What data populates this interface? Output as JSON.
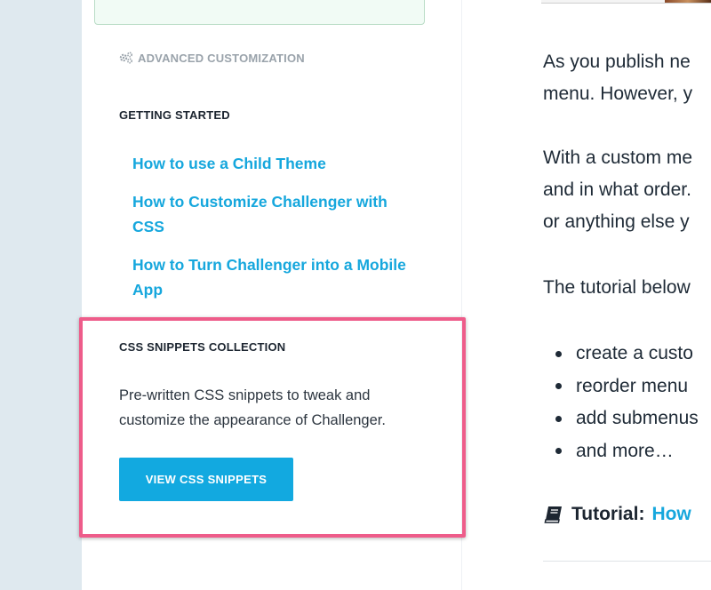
{
  "sidebar": {
    "advanced_label": "ADVANCED CUSTOMIZATION",
    "advanced_icon": "gears-icon",
    "getting_started": {
      "heading": "GETTING STARTED",
      "links": [
        {
          "line1": "How to use a Child Theme",
          "line2": ""
        },
        {
          "line1": "How to Customize Challenger with",
          "line2": "CSS"
        },
        {
          "line1": "How to Turn Challenger into a Mobile",
          "line2": "App"
        }
      ]
    },
    "snippets": {
      "heading": "CSS SNIPPETS COLLECTION",
      "desc_line1": "Pre-written CSS snippets to tweak and",
      "desc_line2": "customize the appearance of Challenger.",
      "button_label": "VIEW CSS SNIPPETS"
    }
  },
  "main": {
    "paragraphs": [
      {
        "line1": "As you publish ne",
        "line2": "menu. However, y",
        "line3": ""
      },
      {
        "line1": "With a custom me",
        "line2": "and in what order.",
        "line3": "or anything else y"
      },
      {
        "line1": "The tutorial below",
        "line2": "",
        "line3": ""
      }
    ],
    "bullets": [
      "create a custo",
      "reorder menu",
      "add submenus",
      "and more…"
    ],
    "tutorial": {
      "icon": "book-icon",
      "label": "Tutorial:",
      "link": "How"
    }
  },
  "colors": {
    "link": "#16a7dd",
    "button": "#12a9e0",
    "highlight": "#ee5c8a",
    "left_gutter": "#dfe9ef"
  }
}
